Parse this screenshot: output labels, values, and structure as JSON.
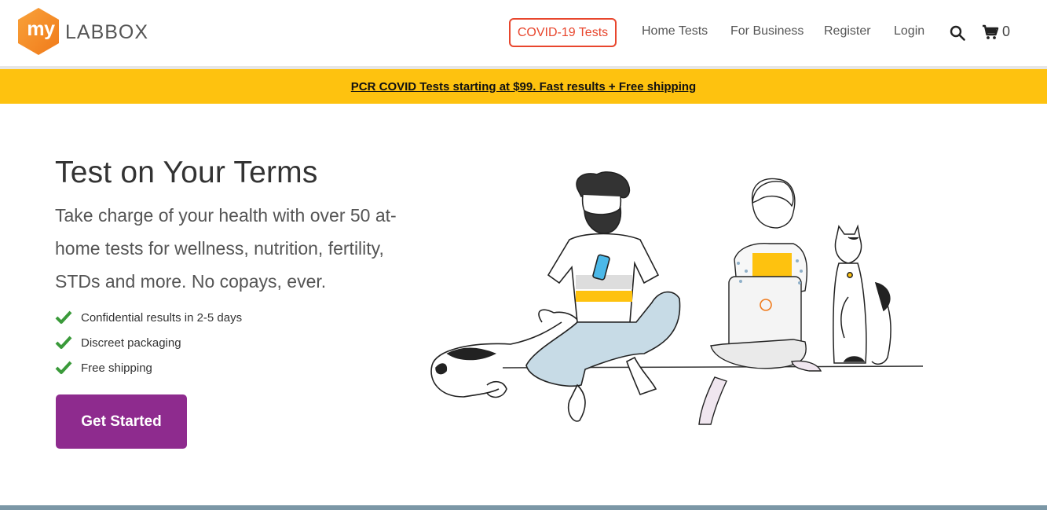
{
  "brand": {
    "logo_prefix": "my",
    "logo_word": "LABBOX",
    "colors": {
      "orange": "#f7941d",
      "red": "#e8462d",
      "purple": "#8e2b8e",
      "yellow": "#fec20f",
      "green": "#3a9a3a"
    }
  },
  "nav": {
    "covid_button": "COVID-19 Tests",
    "links": [
      "Home Tests",
      "For Business",
      "Register",
      "Login"
    ],
    "search_icon": "search-icon",
    "cart_icon": "cart-icon",
    "cart_count": "0"
  },
  "promo": {
    "text": "PCR COVID Tests starting at $99. Fast results + Free shipping"
  },
  "hero": {
    "title": "Test on Your Terms",
    "subtitle": "Take charge of your health with over 50 at-home tests for wellness, nutrition, fertility, STDs and more. No copays, ever.",
    "features": [
      "Confidential results in 2-5 days",
      "Discreet packaging",
      "Free shipping"
    ],
    "cta": "Get Started"
  }
}
